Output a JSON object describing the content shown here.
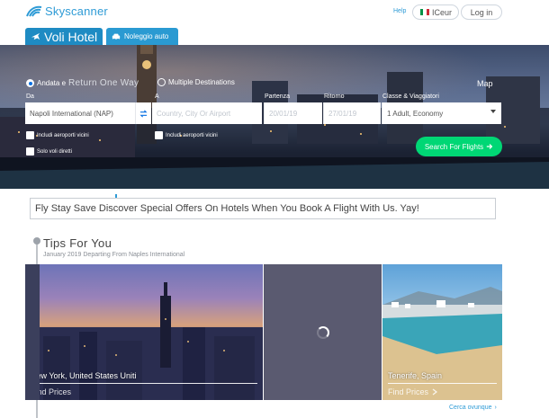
{
  "header": {
    "logo_text": "Skyscanner",
    "help": "Help",
    "language": "ICeur",
    "login": "Log in"
  },
  "tabs": {
    "flights": "Voli Hotel",
    "cars": "Noleggio auto"
  },
  "search": {
    "trip_types": {
      "return": "Andata e",
      "one_way_fade": "Return  One  Way",
      "multi": "Multiple Destinations"
    },
    "map_link": "Map",
    "labels": {
      "from": "Da",
      "to": "A",
      "depart": "Partenza",
      "return": "Ritorno",
      "class": "Classe & Viaggiatori"
    },
    "from_value": "Napoli International (NAP)",
    "to_placeholder": "Country, City Or Airport",
    "depart_value": "20/01/19",
    "return_value": "27/01/19",
    "class_value": "1 Adult, Economy",
    "nearby_from": "Includi aeroporti vicini",
    "nearby_to": "Includi aeroporti vicini",
    "direct_only": "Solo voli diretti",
    "search_button": "Search For Flights"
  },
  "promo": {
    "text": "Fly Stay Save Discover Special Offers On Hotels When You Book A Flight With Us. Yay!"
  },
  "tips": {
    "title": "Tips For You",
    "subtitle": "January 2019 Departing From Naples International",
    "cards": [
      {
        "caption": "New York, United States Uniti",
        "cta": "Find Prices"
      },
      {
        "caption": "",
        "cta": ""
      },
      {
        "caption": "Tenerife, Spain",
        "cta": "Find Prices"
      }
    ],
    "search_anywhere": "Cerca ovunque"
  },
  "colors": {
    "brand": "#0770e3",
    "accent_green": "#00d775",
    "logo_blue": "#2e9bd6"
  },
  "icons": {
    "logo": "skyscanner-sunrise-icon",
    "plane": "plane-icon",
    "car": "car-icon",
    "swap": "swap-arrows-icon",
    "arrow": "arrow-right-icon",
    "chevron": "chevron-down-icon",
    "loading": "spinner-icon"
  }
}
